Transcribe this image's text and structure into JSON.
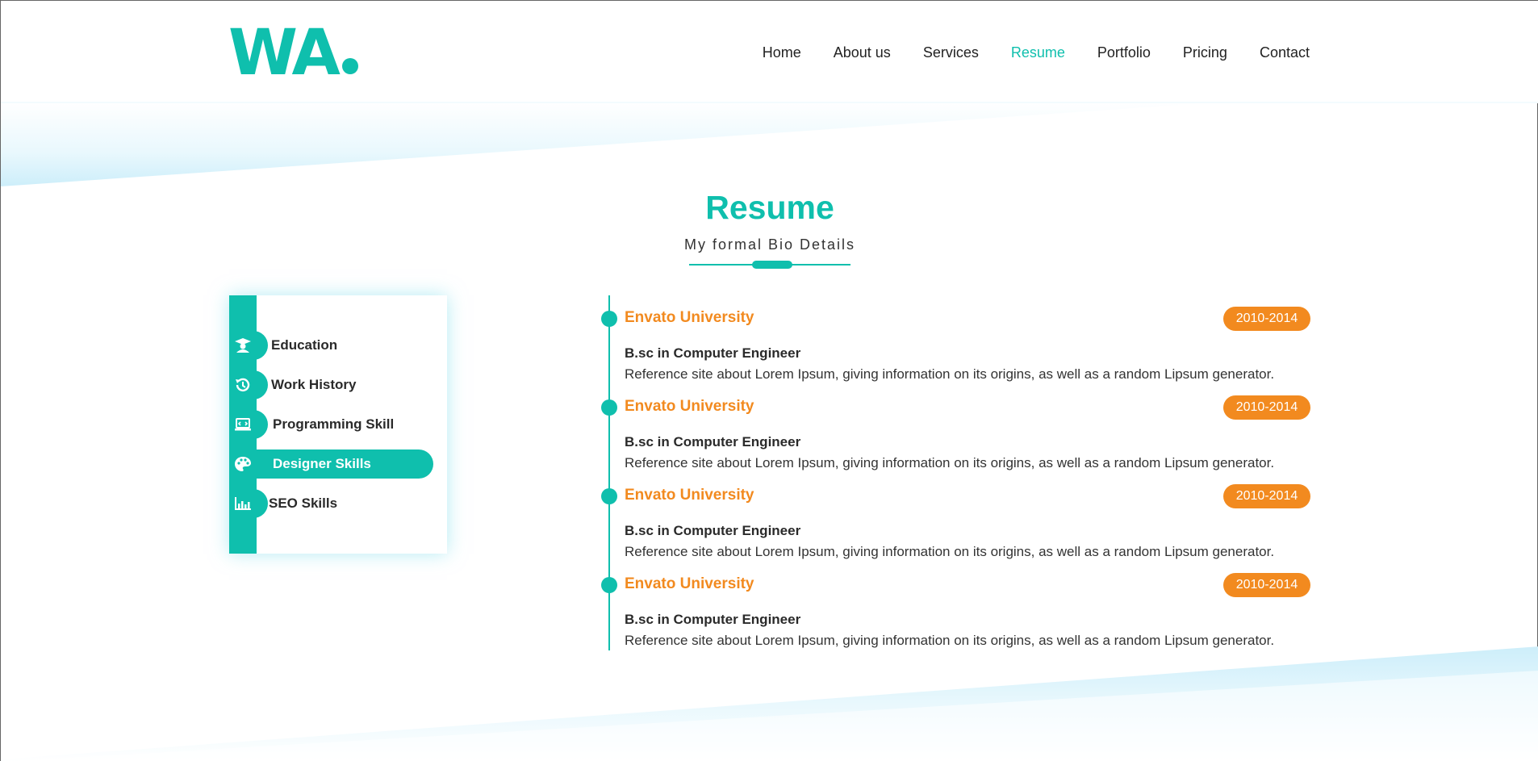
{
  "header": {
    "logo_text": "WA",
    "nav": [
      {
        "label": "Home"
      },
      {
        "label": "About us"
      },
      {
        "label": "Services"
      },
      {
        "label": "Resume",
        "active": true
      },
      {
        "label": "Portfolio"
      },
      {
        "label": "Pricing"
      },
      {
        "label": "Contact"
      }
    ]
  },
  "section": {
    "title": "Resume",
    "subtitle": "My formal Bio Details"
  },
  "tabs": [
    {
      "label": "Education",
      "icon": "graduate-icon"
    },
    {
      "label": "Work History",
      "icon": "history-icon"
    },
    {
      "label": "Programming Skill",
      "icon": "laptop-code-icon"
    },
    {
      "label": "Designer Skills",
      "icon": "palette-icon",
      "active": true
    },
    {
      "label": "SEO Skills",
      "icon": "bar-chart-icon"
    }
  ],
  "timeline": [
    {
      "school": "Envato University",
      "years": "2010-2014",
      "degree": "B.sc in Computer Engineer",
      "description": "Reference site about Lorem Ipsum, giving information on its origins, as well as a random Lipsum generator."
    },
    {
      "school": "Envato University",
      "years": "2010-2014",
      "degree": "B.sc in Computer Engineer",
      "description": "Reference site about Lorem Ipsum, giving information on its origins, as well as a random Lipsum generator."
    },
    {
      "school": "Envato University",
      "years": "2010-2014",
      "degree": "B.sc in Computer Engineer",
      "description": "Reference site about Lorem Ipsum, giving information on its origins, as well as a random Lipsum generator."
    },
    {
      "school": "Envato University",
      "years": "2010-2014",
      "degree": "B.sc in Computer Engineer",
      "description": "Reference site about Lorem Ipsum, giving information on its origins, as well as a random Lipsum generator."
    }
  ],
  "colors": {
    "accent": "#0fbfad",
    "highlight": "#f28a1f",
    "band": "#d6f2fb"
  }
}
